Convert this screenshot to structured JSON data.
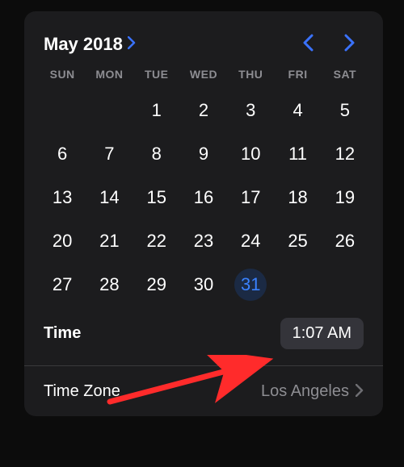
{
  "header": {
    "month_label": "May 2018"
  },
  "weekdays": [
    "SUN",
    "MON",
    "TUE",
    "WED",
    "THU",
    "FRI",
    "SAT"
  ],
  "calendar": {
    "offset": 2,
    "days": 31,
    "selected": 31
  },
  "time": {
    "label": "Time",
    "value": "1:07 AM"
  },
  "timezone": {
    "label": "Time Zone",
    "value": "Los Angeles"
  }
}
